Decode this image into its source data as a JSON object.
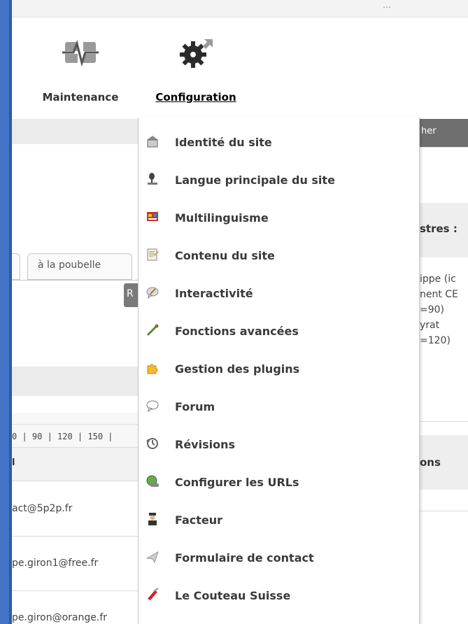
{
  "topbar": {
    "text": "…"
  },
  "nav": {
    "maintenance_label": "Maintenance",
    "configuration_label": "Configuration"
  },
  "background_left": {
    "tab_trash": "à la poubelle",
    "button_r": "R",
    "pager": "0 | 90 | 120 | 150 |",
    "column_header": "l",
    "emails": [
      "act@5p2p.fr",
      "pe.giron1@free.fr",
      "pe.giron@orange.fr"
    ]
  },
  "background_right": {
    "header": "her",
    "section_title": "stres :",
    "list": [
      "ippe (ic",
      "nent CE",
      "=90)",
      "yrat",
      "=120)"
    ],
    "section2_title": "ons"
  },
  "menu": {
    "items": [
      {
        "label": "Identité du site",
        "icon": "site-identity-icon"
      },
      {
        "label": "Langue principale du site",
        "icon": "language-icon"
      },
      {
        "label": "Multilinguisme",
        "icon": "multilingual-icon"
      },
      {
        "label": "Contenu du site",
        "icon": "content-icon"
      },
      {
        "label": "Interactivité",
        "icon": "interactivity-icon"
      },
      {
        "label": "Fonctions avancées",
        "icon": "advanced-functions-icon"
      },
      {
        "label": "Gestion des plugins",
        "icon": "plugins-icon"
      },
      {
        "label": "Forum",
        "icon": "forum-icon"
      },
      {
        "label": "Révisions",
        "icon": "revisions-icon"
      },
      {
        "label": "Configurer les URLs",
        "icon": "urls-icon"
      },
      {
        "label": "Facteur",
        "icon": "mailman-icon"
      },
      {
        "label": "Formulaire de contact",
        "icon": "contact-form-icon"
      },
      {
        "label": "Le Couteau Suisse",
        "icon": "swiss-knife-icon"
      }
    ]
  },
  "colors": {
    "frame_blue": "#4472c4",
    "menu_text": "#3a3a3a",
    "header_gray": "#6f6f6f"
  }
}
